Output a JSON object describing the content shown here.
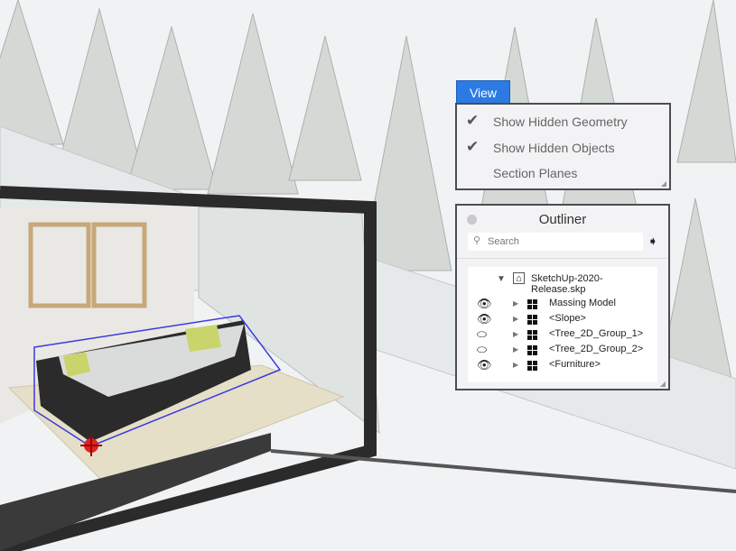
{
  "view_menu": {
    "tab_label": "View",
    "items": [
      {
        "label": "Show Hidden Geometry",
        "checked": true
      },
      {
        "label": "Show Hidden Objects",
        "checked": true
      },
      {
        "label": "Section Planes",
        "checked": false
      }
    ]
  },
  "outliner": {
    "title": "Outliner",
    "search_placeholder": "Search",
    "root": "SketchUp-2020-Release.skp",
    "items": [
      {
        "label": "Massing Model",
        "visible": true
      },
      {
        "label": "<Slope>",
        "visible": true
      },
      {
        "label": "<Tree_2D_Group_1>",
        "visible": false
      },
      {
        "label": "<Tree_2D_Group_2>",
        "visible": false
      },
      {
        "label": "<Furniture>",
        "visible": true
      }
    ]
  },
  "colors": {
    "accent": "#2c7be5",
    "selection": "#3a3adf",
    "frame": "#2b2b2b"
  }
}
